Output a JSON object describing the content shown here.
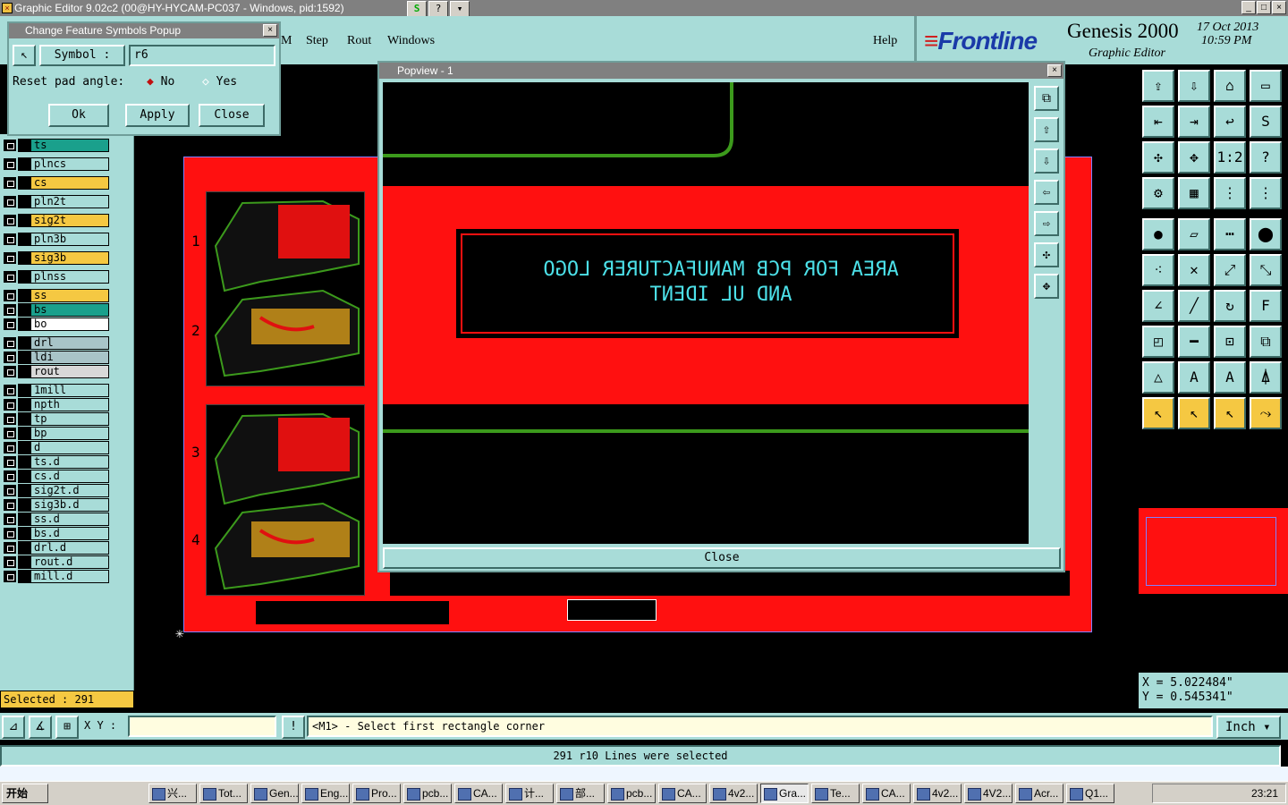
{
  "window": {
    "title": "Graphic Editor 9.02c2 (00@HY-HYCAM-PC037 - Windows, pid:1592)",
    "title_tools": [
      "S",
      "?",
      "▾"
    ]
  },
  "menu": {
    "items": [
      "M",
      "Step",
      "Rout",
      "Windows",
      "Help"
    ]
  },
  "brand": {
    "logo": "Frontline",
    "product": "Genesis 2000",
    "subtitle": "Graphic Editor",
    "date": "17 Oct 2013",
    "time": "10:59 PM"
  },
  "symbol_popup": {
    "title": "Change Feature Symbols Popup",
    "symbol_label": "Symbol :",
    "symbol_value": "r6",
    "reset_label": "Reset pad angle:",
    "option_no": "No",
    "option_yes": "Yes",
    "selected_option": "No",
    "ok": "Ok",
    "apply": "Apply",
    "close": "Close"
  },
  "layers": [
    {
      "name": "ts",
      "color": "#1aa08c"
    },
    {
      "name": "plncs",
      "color": "#a8dcd8"
    },
    {
      "name": "cs",
      "color": "#f5c842"
    },
    {
      "name": "pln2t",
      "color": "#a8dcd8"
    },
    {
      "name": "sig2t",
      "color": "#f5c842"
    },
    {
      "name": "pln3b",
      "color": "#a8dcd8"
    },
    {
      "name": "sig3b",
      "color": "#f5c842"
    },
    {
      "name": "plnss",
      "color": "#a8dcd8"
    },
    {
      "name": "ss",
      "color": "#f5c842"
    },
    {
      "name": "bs",
      "color": "#1aa08c"
    },
    {
      "name": "bo",
      "color": "#ffffff"
    },
    {
      "name": "drl",
      "color": "#a8c4c8"
    },
    {
      "name": "ldi",
      "color": "#a8c4c8"
    },
    {
      "name": "rout",
      "color": "#d8d8d8"
    },
    {
      "name": "1mill",
      "color": "#a8dcd8"
    },
    {
      "name": "npth",
      "color": "#a8dcd8"
    },
    {
      "name": "tp",
      "color": "#a8dcd8"
    },
    {
      "name": "bp",
      "color": "#a8dcd8"
    },
    {
      "name": "d",
      "color": "#a8dcd8"
    },
    {
      "name": "ts.d",
      "color": "#a8dcd8"
    },
    {
      "name": "cs.d",
      "color": "#a8dcd8"
    },
    {
      "name": "sig2t.d",
      "color": "#a8dcd8"
    },
    {
      "name": "sig3b.d",
      "color": "#a8dcd8"
    },
    {
      "name": "ss.d",
      "color": "#a8dcd8"
    },
    {
      "name": "bs.d",
      "color": "#a8dcd8"
    },
    {
      "name": "drl.d",
      "color": "#a8dcd8"
    },
    {
      "name": "rout.d",
      "color": "#a8dcd8"
    },
    {
      "name": "mill.d",
      "color": "#a8dcd8"
    }
  ],
  "selected_count_text": "Selected : 291",
  "board": {
    "panel_numbers": [
      "1",
      "2",
      "3",
      "4"
    ],
    "accent_red": "#ff1010",
    "trace_green": "#3c9a1c"
  },
  "popview": {
    "title": "Popview - 1",
    "logo_line1": "AREA FOR PCB MANUFACTURER LOGO",
    "logo_line2": "AND UL IDENT",
    "close": "Close"
  },
  "coords": {
    "x": "X = 5.022484\"",
    "y": "Y = 0.545341\""
  },
  "command": {
    "xy_label": "X Y :",
    "xy_value": "",
    "prompt": "<M1> - Select first rectangle corner",
    "unit": "Inch"
  },
  "message": "291 r10 Lines were selected",
  "taskbar": {
    "start": "开始",
    "tasks": [
      "兴...",
      "Tot...",
      "Gen...",
      "Eng...",
      "Pro...",
      "pcb...",
      "CA...",
      "计...",
      "部...",
      "pcb...",
      "CA...",
      "4v2...",
      "Gra...",
      "Te...",
      "CA...",
      "4v2...",
      "4V2...",
      "Acr...",
      "Q1..."
    ],
    "active_task": "Gra...",
    "clock": "23:21"
  }
}
